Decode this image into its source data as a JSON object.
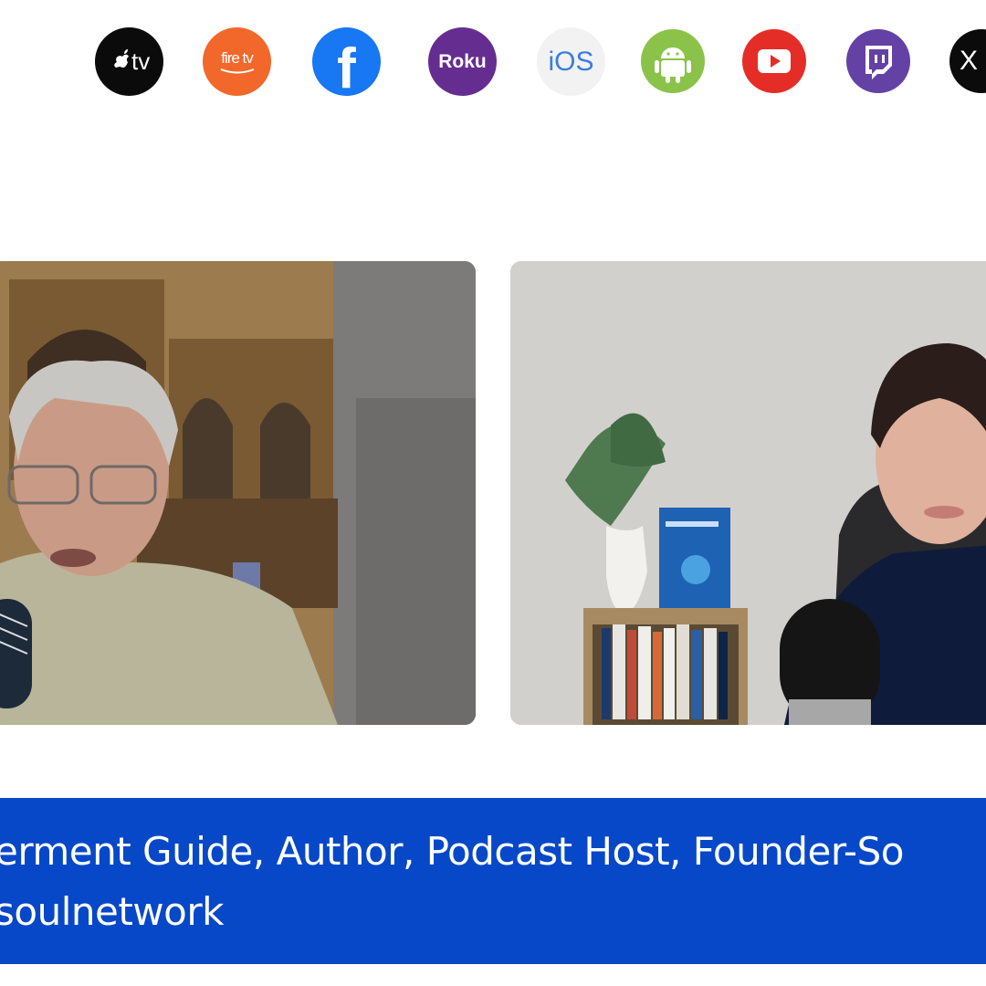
{
  "colors": {
    "background": "#ffffff",
    "banner": "#0648c8",
    "banner_text": "#ffffff"
  },
  "platforms": [
    {
      "name": "Apple TV",
      "icon": "apple-tv-icon",
      "label": "tv",
      "color": "#0b0b0b"
    },
    {
      "name": "Fire TV",
      "icon": "fire-tv-icon",
      "label": "fire tv",
      "color": "#f2682a"
    },
    {
      "name": "Facebook",
      "icon": "facebook-icon",
      "label": "f",
      "color": "#1877f2"
    },
    {
      "name": "Roku",
      "icon": "roku-icon",
      "label": "Roku",
      "color": "#662d91"
    },
    {
      "name": "iOS",
      "icon": "ios-icon",
      "label": "iOS",
      "color": "#f2f2f2"
    },
    {
      "name": "Android",
      "icon": "android-icon",
      "label": "",
      "color": "#8bc34a"
    },
    {
      "name": "YouTube",
      "icon": "youtube-icon",
      "label": "",
      "color": "#e52d27"
    },
    {
      "name": "Twitch",
      "icon": "twitch-icon",
      "label": "",
      "color": "#6441a5"
    },
    {
      "name": "X",
      "icon": "x-icon",
      "label": "X",
      "color": "#0b0b0b"
    }
  ],
  "banner": {
    "line1": "erment Guide, Author, Podcast Host, Founder-So",
    "line2": "soulnetwork"
  }
}
